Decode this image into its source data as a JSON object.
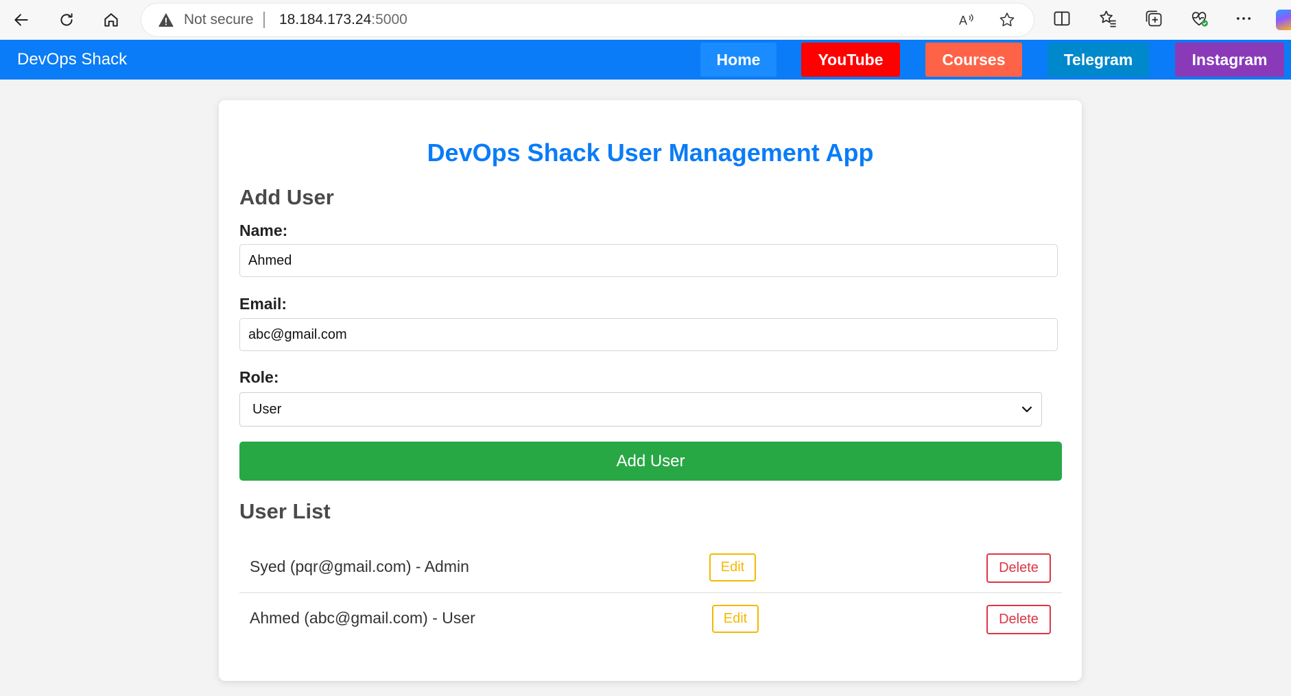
{
  "browser": {
    "not_secure_label": "Not secure",
    "url_host": "18.184.173.24",
    "url_port": ":5000"
  },
  "navbar": {
    "brand": "DevOps Shack",
    "links": [
      {
        "label": "Home",
        "color": "#1a8cff"
      },
      {
        "label": "YouTube",
        "color": "#ff0000"
      },
      {
        "label": "Courses",
        "color": "#ff6347"
      },
      {
        "label": "Telegram",
        "color": "#0088cc"
      },
      {
        "label": "Instagram",
        "color": "#8a3ab9"
      }
    ]
  },
  "app": {
    "title": "DevOps Shack User Management App",
    "add_user_heading": "Add User",
    "form": {
      "name_label": "Name:",
      "name_value": "Ahmed",
      "email_label": "Email:",
      "email_value": "abc@gmail.com",
      "role_label": "Role:",
      "role_value": "User"
    },
    "add_button_label": "Add User",
    "user_list_heading": "User List",
    "users": [
      {
        "text": "Syed (pqr@gmail.com) - Admin",
        "edit_label": "Edit",
        "delete_label": "Delete"
      },
      {
        "text": "Ahmed (abc@gmail.com) - User",
        "edit_label": "Edit",
        "delete_label": "Delete"
      }
    ]
  },
  "colors": {
    "navbar_bg": "#0a7cf7",
    "title_color": "#0a7cf7",
    "add_button": "#28a745",
    "edit": "#f5b800",
    "delete": "#dc3545"
  }
}
